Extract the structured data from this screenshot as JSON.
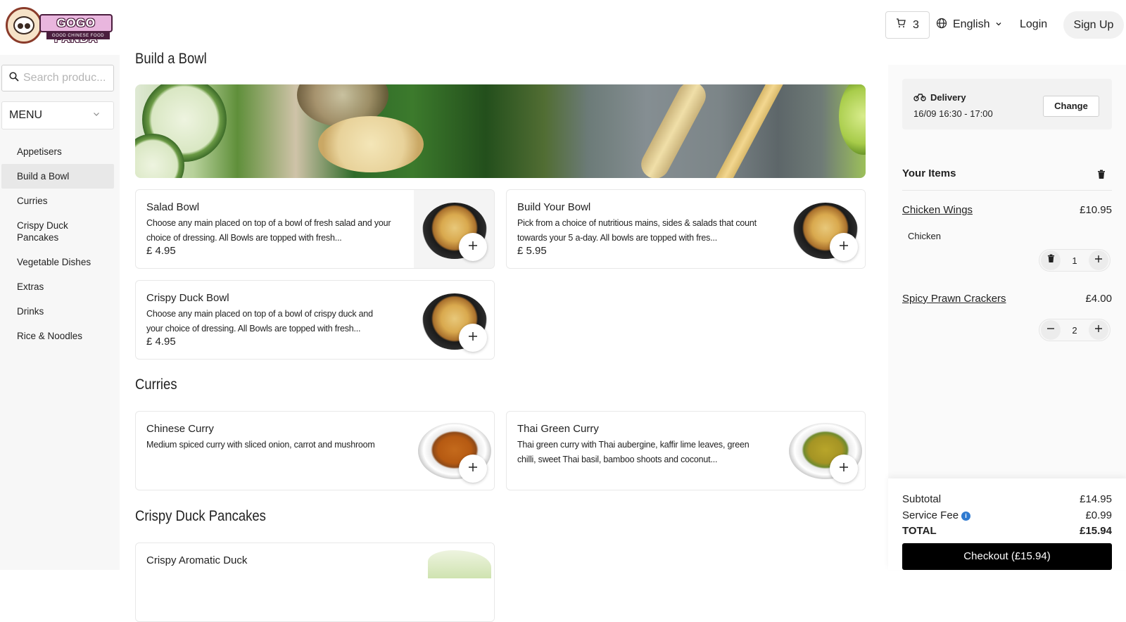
{
  "header": {
    "brand": "GOGO PANDA",
    "brand_sub": "GOOD CHINESE FOOD",
    "cart_count": "3",
    "language": "English",
    "login": "Login",
    "signup": "Sign Up"
  },
  "sidebar": {
    "search_placeholder": "Search produc...",
    "menu_label": "MENU",
    "items": [
      {
        "label": "Appetisers"
      },
      {
        "label": "Build a Bowl"
      },
      {
        "label": "Curries"
      },
      {
        "label": "Crispy Duck Pancakes"
      },
      {
        "label": "Vegetable Dishes"
      },
      {
        "label": "Extras"
      },
      {
        "label": "Drinks"
      },
      {
        "label": "Rice & Noodles"
      }
    ],
    "active_item": "Build a Bowl"
  },
  "sections": [
    {
      "title": "Build a Bowl",
      "products": [
        {
          "name": "Salad Bowl",
          "desc": "Choose any main placed on top of a bowl of fresh salad and your choice of dressing. All Bowls are topped with fresh...",
          "price": "£ 4.95"
        },
        {
          "name": "Build Your Bowl",
          "desc": "Pick from a choice of nutritious mains, sides & salads that count towards your 5 a-day. All bowls are topped with fres...",
          "price": "£ 5.95"
        },
        {
          "name": "Crispy Duck Bowl",
          "desc": "Choose any main placed on top of a bowl of crispy duck and your choice of dressing. All Bowls are topped with fresh...",
          "price": "£ 4.95"
        }
      ]
    },
    {
      "title": "Curries",
      "products": [
        {
          "name": "Chinese Curry",
          "desc": "Medium spiced curry with sliced onion, carrot and mushroom"
        },
        {
          "name": "Thai Green Curry",
          "desc": "Thai green curry with Thai aubergine, kaffir lime leaves, green chilli, sweet Thai basil, bamboo shoots and coconut..."
        }
      ]
    },
    {
      "title": "Crispy Duck Pancakes",
      "products": [
        {
          "name": "Crispy Aromatic Duck"
        }
      ]
    }
  ],
  "order": {
    "delivery_label": "Delivery",
    "delivery_time": "16/09 16:30 - 17:00",
    "change_label": "Change",
    "items_title": "Your Items",
    "items": [
      {
        "name": "Chicken Wings",
        "price": "£10.95",
        "option": "Chicken",
        "qty": "1"
      },
      {
        "name": "Spicy Prawn Crackers",
        "price": "£4.00",
        "qty": "2"
      }
    ],
    "subtotal_label": "Subtotal",
    "subtotal": "£14.95",
    "service_fee_label": "Service Fee",
    "service_fee": "£0.99",
    "total_label": "TOTAL",
    "total": "£15.94",
    "checkout_label": "Checkout (£15.94)"
  },
  "colors": {
    "accent": "#000000",
    "info": "#2f7ad0",
    "sidebar_bg": "#f7f7f7",
    "active_bg": "#e8e8e8"
  },
  "icons": [
    "cart-icon",
    "globe-icon",
    "chevron-down-icon",
    "search-icon",
    "plus-icon",
    "minus-icon",
    "trash-icon",
    "bike-icon",
    "info-icon"
  ]
}
